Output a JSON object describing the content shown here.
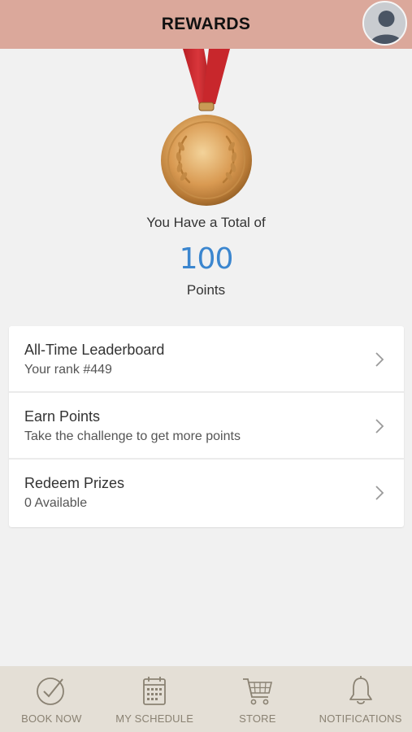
{
  "header": {
    "title": "REWARDS"
  },
  "rewards": {
    "total_label": "You Have a Total of",
    "points": "100",
    "points_label": "Points"
  },
  "menu": {
    "items": [
      {
        "title": "All-Time Leaderboard",
        "subtitle": "Your rank #449"
      },
      {
        "title": "Earn Points",
        "subtitle": "Take the challenge to get more points"
      },
      {
        "title": "Redeem Prizes",
        "subtitle": "0 Available"
      }
    ]
  },
  "tabbar": {
    "tabs": [
      {
        "label": "BOOK NOW",
        "icon": "check-circle-icon"
      },
      {
        "label": "MY SCHEDULE",
        "icon": "calendar-icon"
      },
      {
        "label": "STORE",
        "icon": "cart-icon"
      },
      {
        "label": "NOTIFICATIONS",
        "icon": "bell-icon"
      }
    ]
  },
  "colors": {
    "header_bg": "#dba89b",
    "points_blue": "#3b86cf",
    "tabbar_bg": "#e4dfd6",
    "tab_label": "#8a8273"
  }
}
